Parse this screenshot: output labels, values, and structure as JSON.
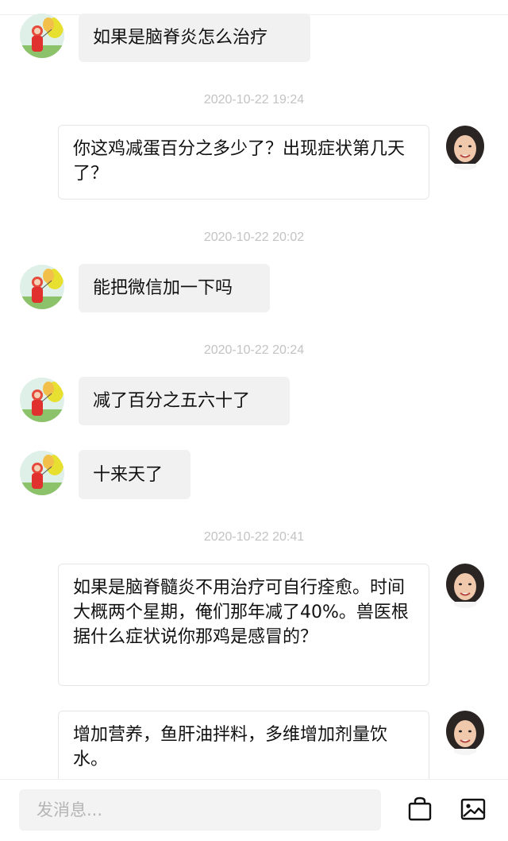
{
  "messages": [
    {
      "side": "in",
      "text": "如果是脑脊炎怎么治疗"
    },
    {
      "timestamp": "2020-10-22 19:24"
    },
    {
      "side": "out",
      "text": "你这鸡减蛋百分之多少了？出现症状第几天了？"
    },
    {
      "timestamp": "2020-10-22 20:02"
    },
    {
      "side": "in",
      "text": "能把微信加一下吗"
    },
    {
      "timestamp": "2020-10-22 20:24"
    },
    {
      "side": "in",
      "text": "减了百分之五六十了"
    },
    {
      "side": "in",
      "text": "十来天了"
    },
    {
      "timestamp": "2020-10-22 20:41"
    },
    {
      "side": "out",
      "text": "如果是脑脊髓炎不用治疗可自行痊愈。时间大概两个星期，俺们那年减了40%。兽医根据什么症状说你那鸡是感冒的？"
    },
    {
      "side": "out",
      "text": "增加营养，鱼肝油拌料，多维增加剂量饮水。"
    }
  ],
  "composer": {
    "placeholder": "发消息...",
    "shop_icon": "shopping-bag-icon",
    "image_icon": "image-icon"
  },
  "avatars": {
    "left": "balloon-avatar",
    "right": "user-portrait-avatar"
  }
}
